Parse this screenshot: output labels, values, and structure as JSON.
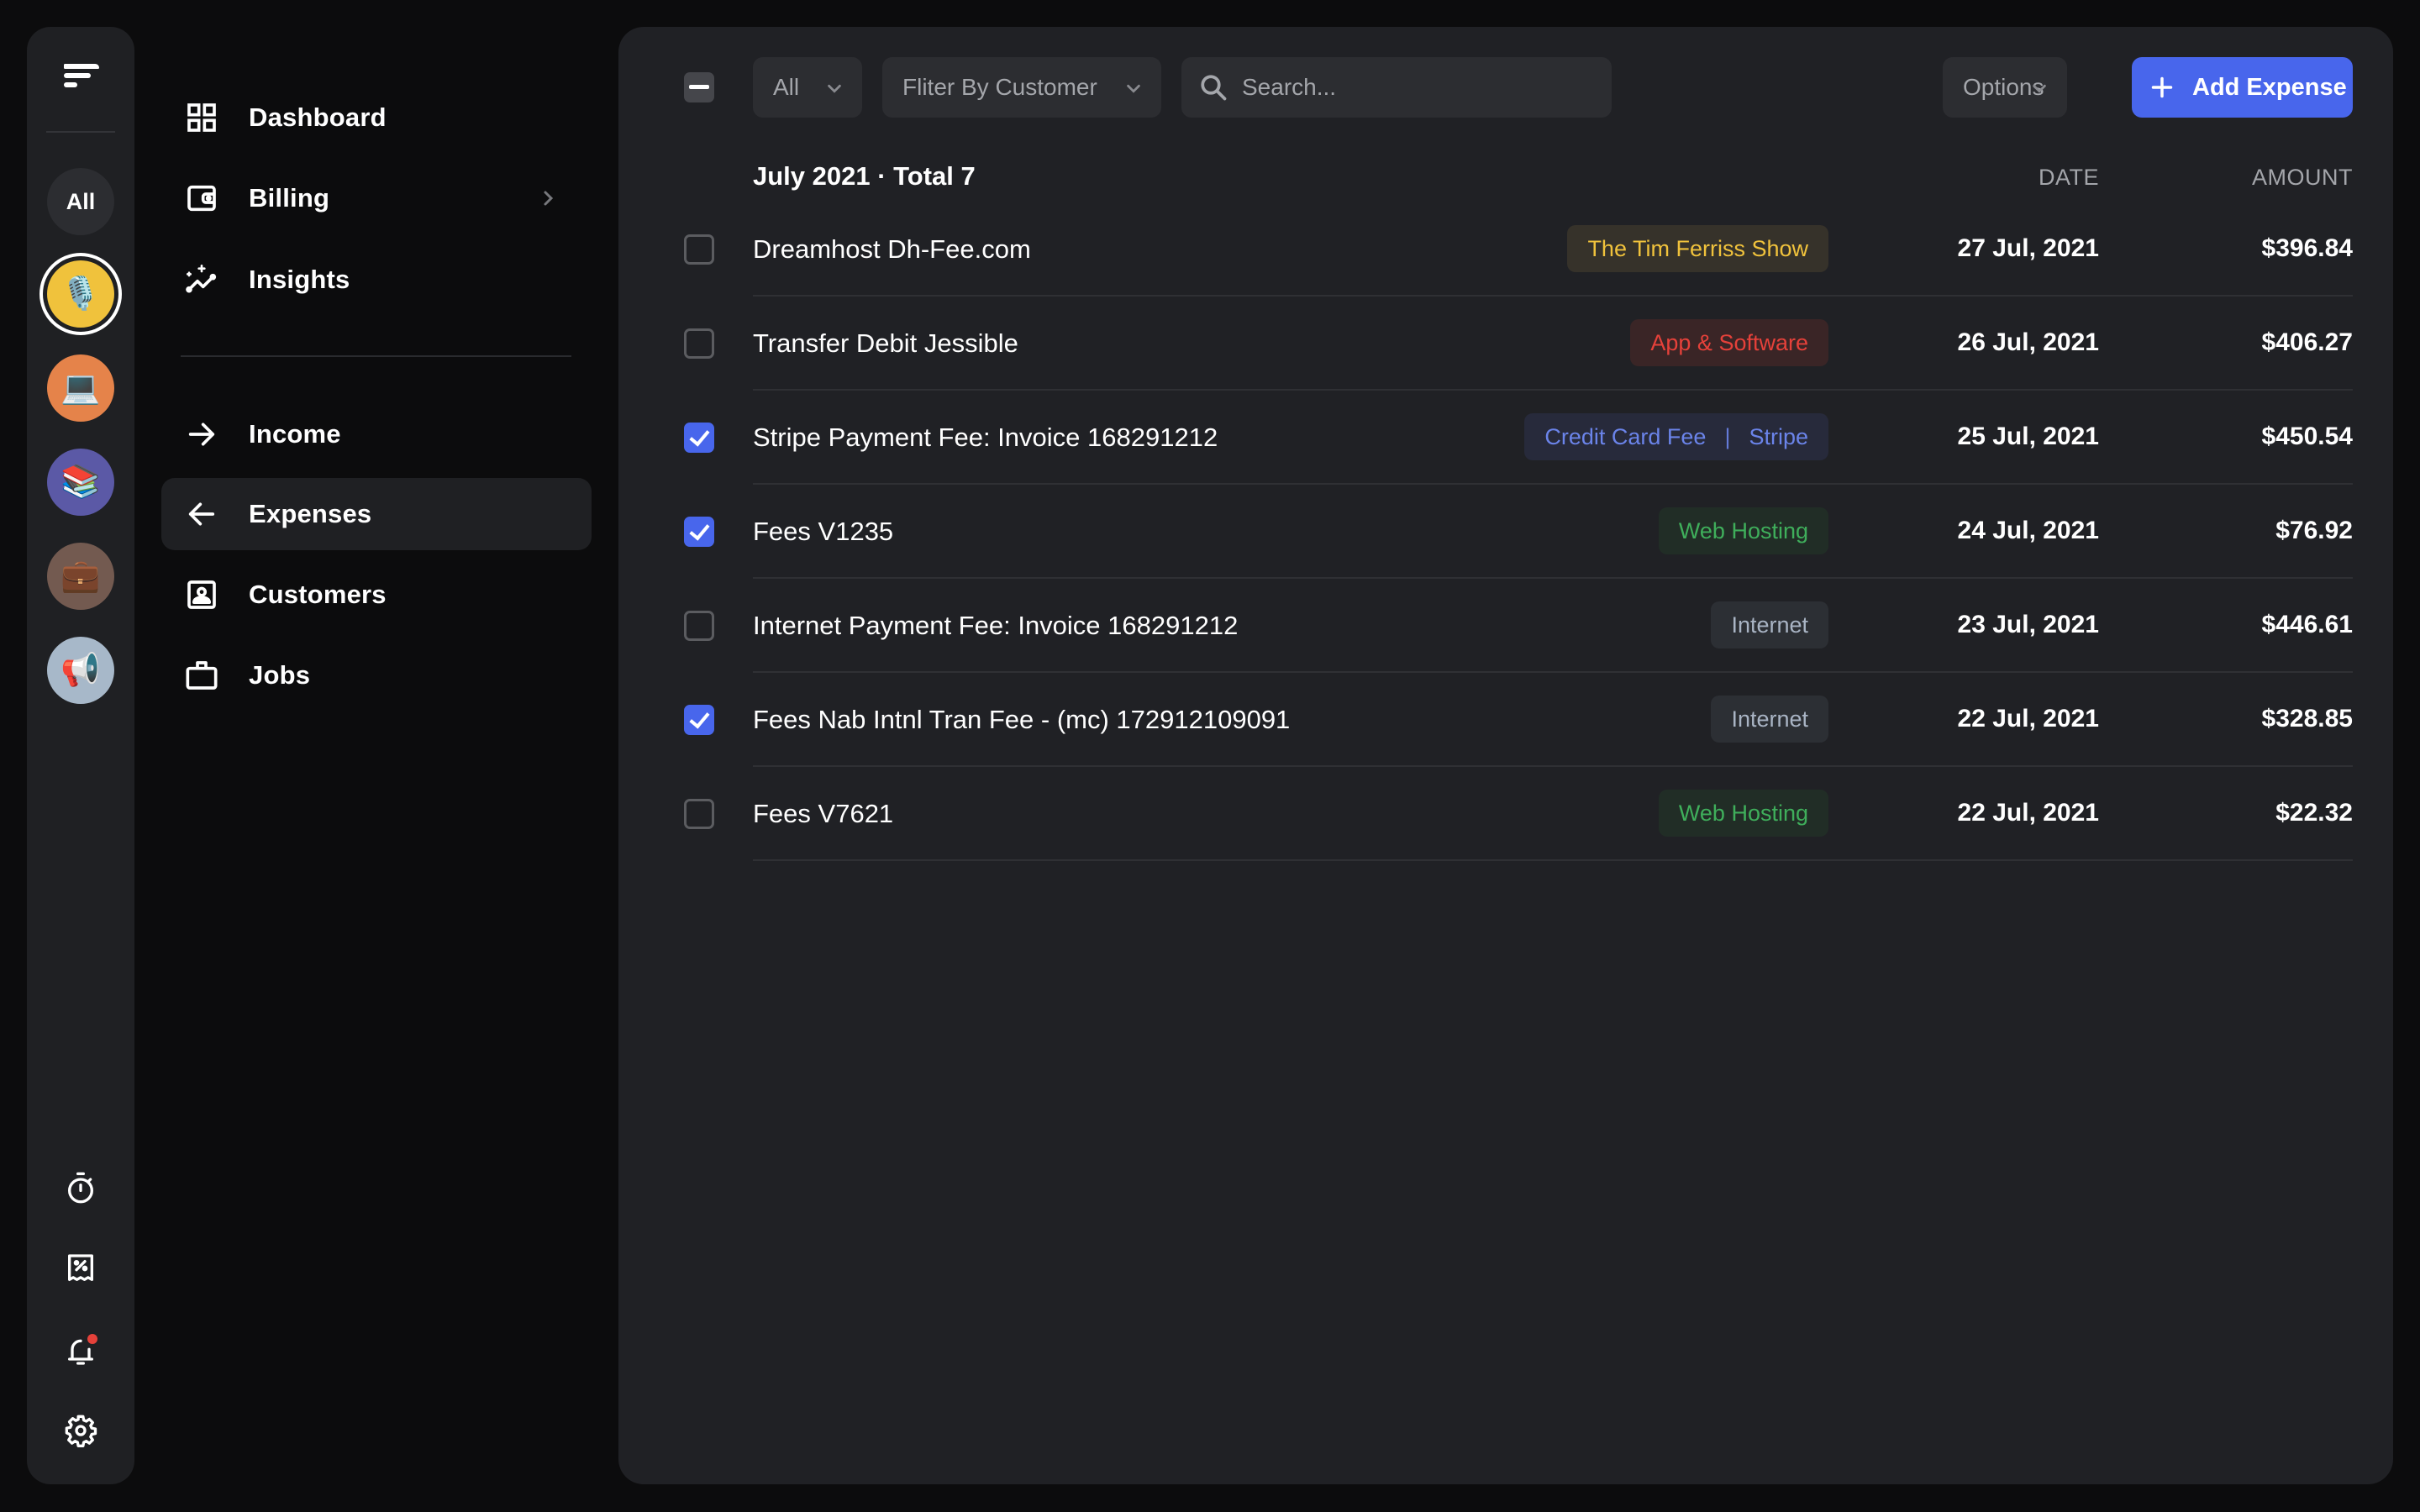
{
  "rail": {
    "logo_icon": "brand-logo-icon",
    "workspaces": [
      {
        "label": "All",
        "type": "text"
      },
      {
        "label": "🎙️",
        "name": "podcast-workspace",
        "color": "#f0c23c",
        "active": true
      },
      {
        "label": "💻",
        "name": "laptop-workspace",
        "color": "#e5834a"
      },
      {
        "label": "📚",
        "name": "books-workspace",
        "color": "#5b59a6"
      },
      {
        "label": "💼",
        "name": "briefcase-workspace",
        "color": "#735a50"
      },
      {
        "label": "📢",
        "name": "megaphone-workspace",
        "color": "#a7b8c9"
      }
    ],
    "bottom_icons": [
      "stopwatch-icon",
      "receipt-percent-icon",
      "bell-icon",
      "gear-icon"
    ],
    "notification_dot_color": "#e5413a"
  },
  "nav": {
    "items": [
      {
        "label": "Dashboard",
        "icon": "grid-icon"
      },
      {
        "label": "Billing",
        "icon": "wallet-icon",
        "has_submenu": true
      },
      {
        "label": "Insights",
        "icon": "sparkle-chart-icon"
      },
      {
        "label": "Income",
        "icon": "arrow-right-icon"
      },
      {
        "label": "Expenses",
        "icon": "arrow-left-icon",
        "active": true
      },
      {
        "label": "Customers",
        "icon": "contact-card-icon"
      },
      {
        "label": "Jobs",
        "icon": "briefcase-icon"
      }
    ]
  },
  "toolbar": {
    "type_filter": "All",
    "customer_filter": "Fliter By Customer",
    "search_placeholder": "Search...",
    "search_value": "",
    "options_label": "Options",
    "add_label": "Add Expense"
  },
  "section": {
    "title": "July 2021 · Total 7",
    "date_header": "DATE",
    "amount_header": "AMOUNT"
  },
  "colors": {
    "accent": "#4866ec",
    "panel_bg": "#202125",
    "page_bg": "#0c0c0d"
  },
  "expenses": [
    {
      "description": "Dreamhost Dh-Fee.com",
      "checked": false,
      "tags": [
        "The Tim Ferriss Show"
      ],
      "tag_style": "yellow",
      "date": "27 Jul, 2021",
      "amount": "$396.84"
    },
    {
      "description": "Transfer Debit Jessible",
      "checked": false,
      "tags": [
        "App & Software"
      ],
      "tag_style": "red",
      "date": "26 Jul, 2021",
      "amount": "$406.27"
    },
    {
      "description": "Stripe Payment Fee: Invoice 168291212",
      "checked": true,
      "tags": [
        "Credit Card Fee",
        "Stripe"
      ],
      "tag_style": "blue",
      "date": "25 Jul, 2021",
      "amount": "$450.54"
    },
    {
      "description": "Fees V1235",
      "checked": true,
      "tags": [
        "Web Hosting"
      ],
      "tag_style": "green",
      "date": "24 Jul, 2021",
      "amount": "$76.92"
    },
    {
      "description": "Internet Payment Fee: Invoice 168291212",
      "checked": false,
      "tags": [
        "Internet"
      ],
      "tag_style": "gray",
      "date": "23 Jul, 2021",
      "amount": "$446.61"
    },
    {
      "description": "Fees Nab Intnl Tran Fee - (mc) 172912109091",
      "checked": true,
      "tags": [
        "Internet"
      ],
      "tag_style": "gray",
      "date": "22 Jul, 2021",
      "amount": "$328.85"
    },
    {
      "description": "Fees V7621",
      "checked": false,
      "tags": [
        "Web Hosting"
      ],
      "tag_style": "green",
      "date": "22 Jul, 2021",
      "amount": "$22.32"
    }
  ],
  "tag_styles": {
    "yellow": {
      "bg": "#36322a",
      "fg": "#f0c23c"
    },
    "red": {
      "bg": "#3a2526",
      "fg": "#e5413a"
    },
    "blue": {
      "bg": "#272a3b",
      "fg": "#6b84ea"
    },
    "green": {
      "bg": "#212d26",
      "fg": "#3fae5b"
    },
    "gray": {
      "bg": "#2c2f34",
      "fg": "#a9b4c4"
    }
  }
}
